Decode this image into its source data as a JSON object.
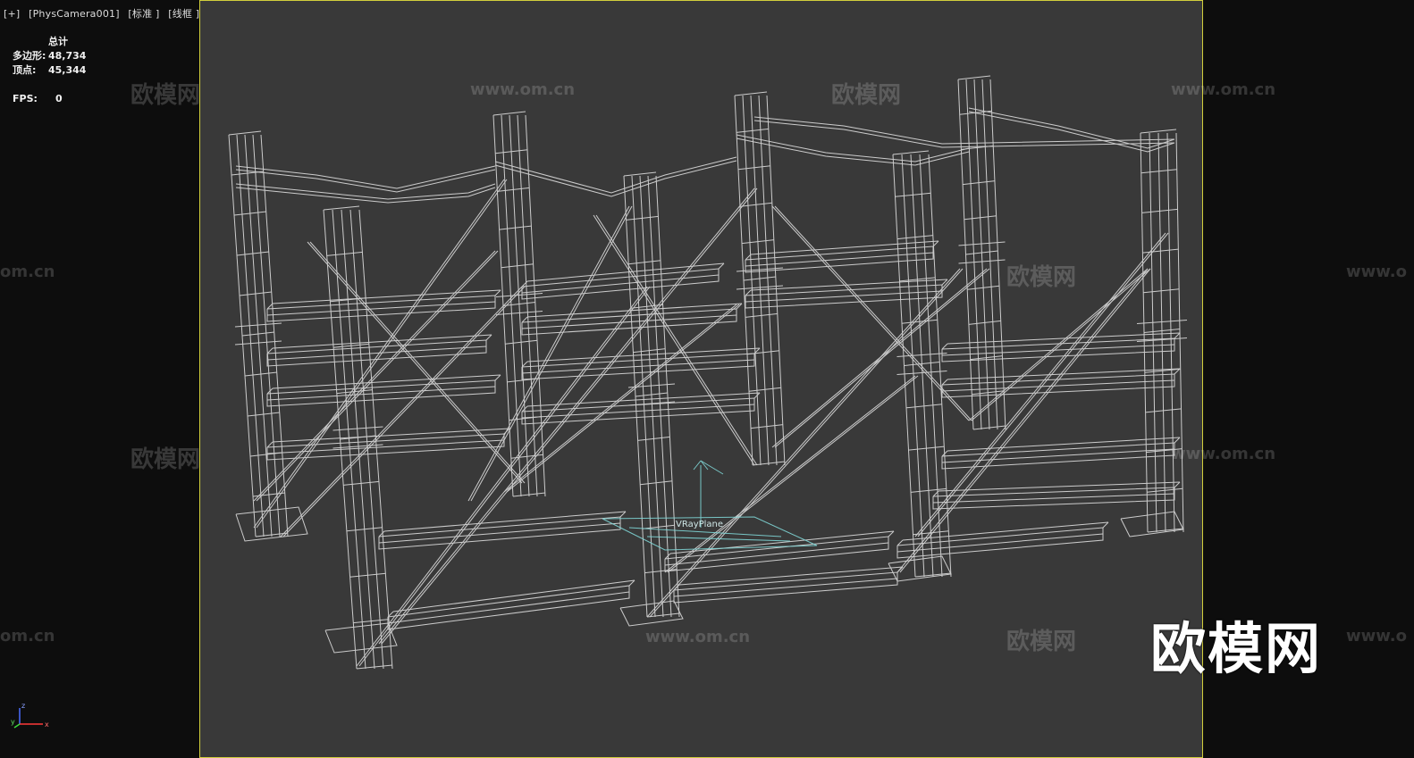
{
  "viewport": {
    "menu": "[+]",
    "camera": "[PhysCamera001]",
    "shading": "[标准 ]",
    "mode": "[线框 ]"
  },
  "stats": {
    "header": "总计",
    "polys_label": "多边形:",
    "polys_value": "48,734",
    "verts_label": "顶点:",
    "verts_value": "45,344",
    "fps_label": "FPS:",
    "fps_value": "0"
  },
  "scene": {
    "object_label": "VRayPlane",
    "wire_color": "#e6e6e6",
    "helper_color": "#7fd6d6"
  },
  "watermark": {
    "logo": "欧模网",
    "url": "www.om.cn",
    "partial_url": "om.cn",
    "partial_url_right": "www.o"
  },
  "axis": {
    "x": "x",
    "y": "y",
    "z": "z"
  },
  "colors": {
    "frame_border": "#d2cf3c",
    "viewport_bg": "#393939",
    "app_bg": "#0d0d0d"
  }
}
